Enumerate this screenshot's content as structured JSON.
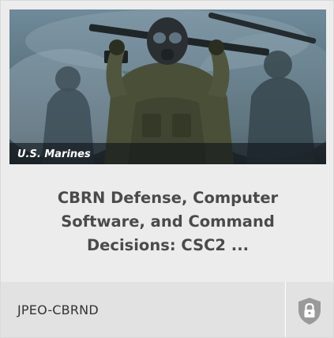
{
  "card": {
    "image_caption": "U.S. Marines",
    "title": "CBRN Defense, Computer Software, and Command Decisions:  CSC2 ...",
    "organization": "JPEO-CBRND",
    "lock_icon": "shield-lock-icon"
  },
  "colors": {
    "card_background": "#ececec",
    "footer_background": "#e2e2e2",
    "title_text": "#4a4a4a",
    "icon": "#9a9a9a"
  }
}
